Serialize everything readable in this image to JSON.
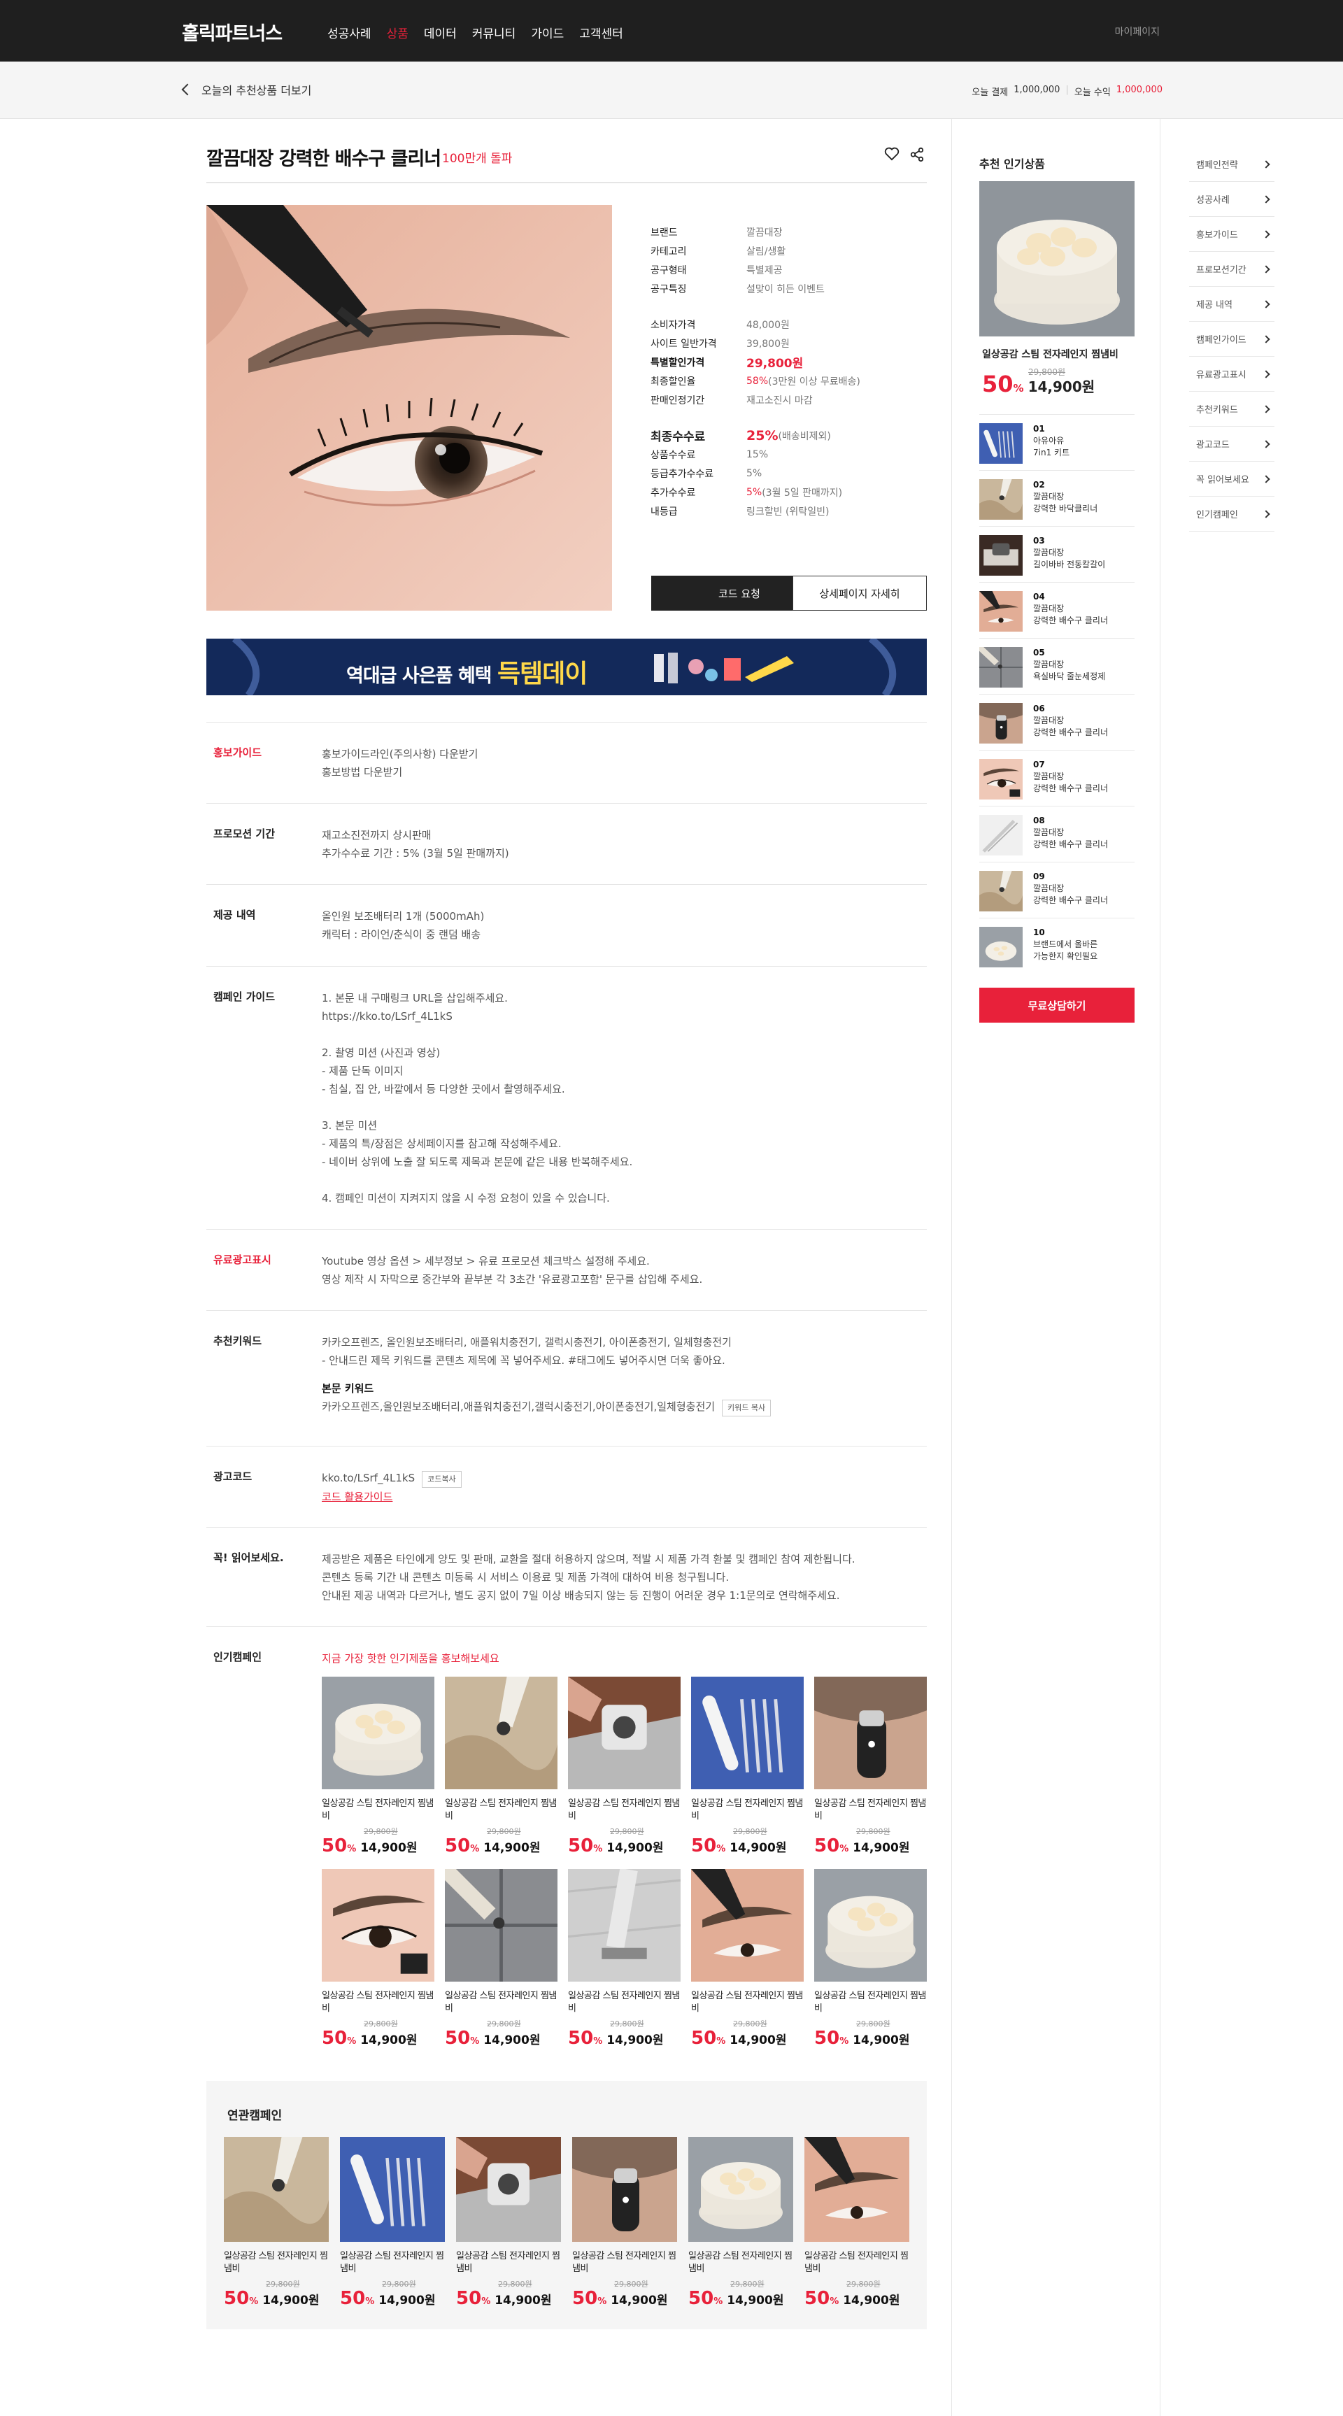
{
  "header": {
    "logo": "홀릭파트너스",
    "nav": [
      "성공사례",
      "상품",
      "데이터",
      "커뮤니티",
      "가이드",
      "고객센터"
    ],
    "active_nav": "상품",
    "mypage": "마이페이지"
  },
  "subbar": {
    "back_label": "오늘의 추천상품 더보기",
    "today_pay_label": "오늘 결제",
    "today_pay_value": "1,000,000",
    "today_income_label": "오늘 수익",
    "today_income_value": "1,000,000"
  },
  "product": {
    "title": "깔끔대장 강력한 배수구 클리너",
    "badge": "100만개 돌파",
    "info": [
      {
        "k": "브랜드",
        "v": "깔끔대장"
      },
      {
        "k": "카테고리",
        "v": "살림/생활"
      },
      {
        "k": "공구형태",
        "v": "특별제공"
      },
      {
        "k": "공구특징",
        "v": "설맞이 히든 이벤트"
      }
    ],
    "price": [
      {
        "k": "소비자가격",
        "v": "48,000원"
      },
      {
        "k": "사이트 일반가격",
        "v": "39,800원"
      },
      {
        "k": "특별할인가격",
        "v": "29,800원"
      },
      {
        "k": "최종할인율",
        "v_red": "58%",
        "v": " (3만원 이상 무료배송)"
      },
      {
        "k": "판매인정기간",
        "v": "재고소진시 마감"
      }
    ],
    "commission": [
      {
        "k": "최종수수료",
        "v_red": "25%",
        "v": "(배송비제외)"
      },
      {
        "k": "상품수수료",
        "v": "15%"
      },
      {
        "k": "등급추가수수료",
        "v": "5%"
      },
      {
        "k": "추가수수료",
        "v_red": "5%",
        "v": " (3월 5일 판매까지)"
      },
      {
        "k": "내등급",
        "v": "링크할빈 (위탁일빈)"
      }
    ],
    "btn_code": "코드 요청",
    "btn_detail": "상세페이지 자세히"
  },
  "banner": {
    "text": "역대급 사은품 혜택",
    "big": "득템데이"
  },
  "sections": {
    "promo_guide": {
      "label": "홍보가이드",
      "line1": "홍보가이드라인(주의사항) 다운받기",
      "line2": "홍보방법 다운받기"
    },
    "promo_period": {
      "label": "프로모션 기간",
      "line1": "재고소진전까지 상시판매",
      "line2": "추가수수료 기간 : 5% (3월 5일 판매까지)"
    },
    "provide": {
      "label": "제공 내역",
      "line1": "올인원 보조배터리 1개 (5000mAh)",
      "line2": "캐릭터 : 라이언/춘식이 중 랜덤 배송"
    },
    "campaign_guide": {
      "label": "캠페인 가이드",
      "text": "1. 본문 내  구매링크 URL을 삽입해주세요.\nhttps://kko.to/LSrf_4L1kS\n\n2. 촬영 미션  (사진과 영상)\n- 제품 단독  이미지\n- 침실, 집 안, 바깥에서 등 다양한 곳에서 촬영해주세요.\n\n3. 본문 미션\n- 제품의  특/장점은 상세페이지를 참고해 작성해주세요.\n- 네이버 상위에  노출 잘 되도록 제목과 본문에 같은 내용 반복해주세요.\n\n4.  캠페인 미션이  지켜지지 않을 시 수정 요청이 있을 수 있습니다."
    },
    "paid_ad": {
      "label": "유료광고표시",
      "text": "Youtube 영상 옵션 > 세부정보  > 유료 프로모션 체크박스 설정해 주세요.\n영상 제작 시 자막으로 중간부와 끝부분 각 3초간 '유료광고포함' 문구를 삽입해 주세요."
    },
    "keywords": {
      "label": "추천키워드",
      "text": "카카오프렌즈,  올인원보조배터리, 애플워치충전기, 갤럭시충전기, 아이폰충전기, 일체형충전기\n- 안내드린 제목  키워드를 콘텐츠 제목에 꼭 넣어주세요. #태그에도 넣어주시면 더욱 좋아요.",
      "body_title": "본문 키워드",
      "body_kw": "카카오프렌즈,올인원보조배터리,애플워치충전기,갤럭시충전기,아이폰충전기,일체형충전기",
      "copy_btn": "키워드 복사"
    },
    "adcode": {
      "label": "광고코드",
      "code": "kko.to/LSrf_4L1kS",
      "copy_btn": "코드복사",
      "guide": "코드 활용가이드"
    },
    "notice": {
      "label": "꼭! 읽어보세요.",
      "text": "제공받은 제품은  타인에게 양도 및 판매, 교환을 절대 허용하지 않으며, 적발 시 제품 가격 환불 및 캠페인 참여 제한됩니다.\n콘텐츠 등록 기간  내 콘텐츠 미등록 시 서비스 이용료 및 제품 가격에 대하여 비용 청구됩니다.\n안내된 제공  내역과 다르거나, 별도 공지 없이 7일 이상 배송되지 않는 등 진행이 어려운 경우 1:1문의로 연락해주세요."
    },
    "popular": {
      "label": "인기캠페인",
      "sub": "지금 가장 핫한  인기제품을 홍보해보세요"
    }
  },
  "card": {
    "name": "일상공감 스팀 전자레인지 찜냄비",
    "old": "29,800원",
    "pct": "50",
    "pct_unit": "%",
    "price": "14,900원"
  },
  "related": {
    "title": "연관캠페인"
  },
  "recommend": {
    "title": "추천 인기상품",
    "name": "일상공감 스팀 전자레인지 찜냄비",
    "old": "29,800원",
    "pct": "50",
    "pct_unit": "%",
    "price": "14,900원",
    "ranks": [
      {
        "num": "01",
        "l1": "아유아유",
        "l2": "7in1 키트"
      },
      {
        "num": "02",
        "l1": "깔끔대장",
        "l2": "강력한 바닥클리너"
      },
      {
        "num": "03",
        "l1": "깔끔대장",
        "l2": "길이바바 전동칼갈이"
      },
      {
        "num": "04",
        "l1": "깔끔대장",
        "l2": "강력한 배수구 클리너"
      },
      {
        "num": "05",
        "l1": "깔끔대장",
        "l2": "욕실바닥 줄눈세정제"
      },
      {
        "num": "06",
        "l1": "깔끔대장",
        "l2": "강력한 배수구 클리너"
      },
      {
        "num": "07",
        "l1": "깔끔대장",
        "l2": "강력한 배수구 클리너"
      },
      {
        "num": "08",
        "l1": "깔끔대장",
        "l2": "강력한 배수구 클리너"
      },
      {
        "num": "09",
        "l1": "깔끔대장",
        "l2": "강력한 배수구 클리너"
      },
      {
        "num": "10",
        "l1": "브랜드에서 올바른",
        "l2": "가능한지 확인필요"
      }
    ],
    "consult": "무료상담하기"
  },
  "side_menu": [
    "캠페인전략",
    "성공사례",
    "홍보가이드",
    "프로모션기간",
    "제공 내역",
    "캠페인가이드",
    "유료광고표시",
    "추천키워드",
    "광고코드",
    "꼭 읽어보세요",
    "인기캠페인"
  ],
  "colors": {
    "accent": "#e8213a",
    "topbar": "#1f1f1f",
    "banner": "#13295a"
  }
}
